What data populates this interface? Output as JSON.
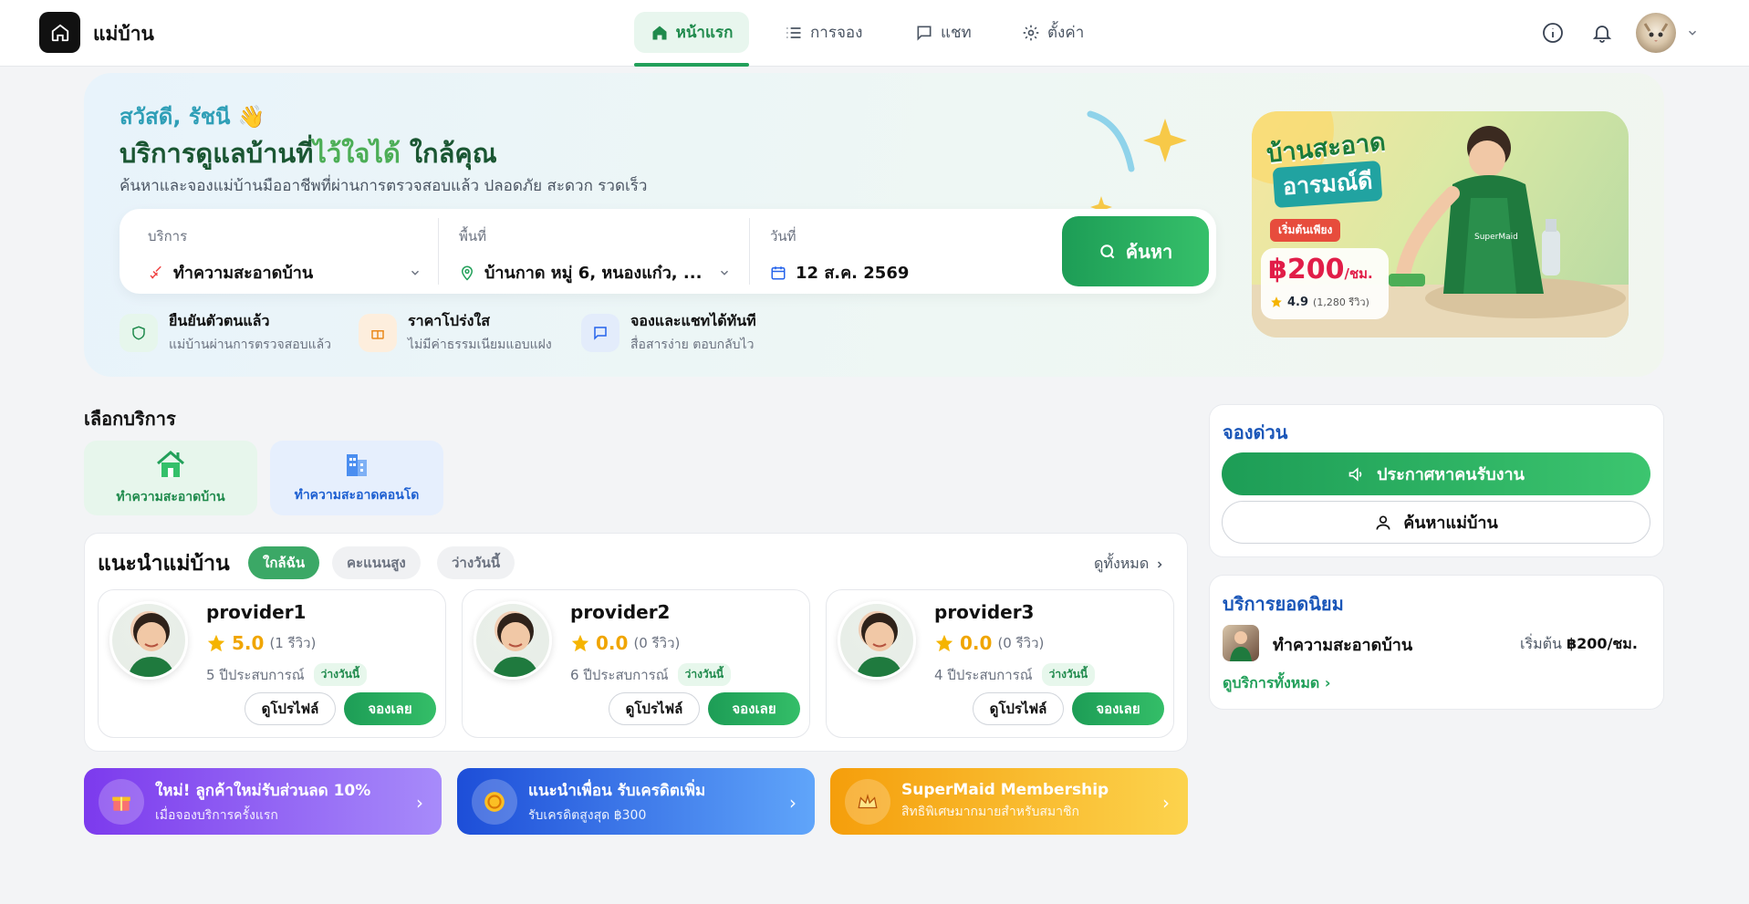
{
  "header": {
    "brand": "แม่บ้าน",
    "nav": [
      {
        "label": "หน้าแรก",
        "icon": "home-icon"
      },
      {
        "label": "การจอง",
        "icon": "list-icon"
      },
      {
        "label": "แชท",
        "icon": "chat-icon"
      },
      {
        "label": "ตั้งค่า",
        "icon": "gear-icon"
      }
    ]
  },
  "hero": {
    "greeting": "สวัสดี, รัชนี 👋",
    "headline_a": "บริการดูแลบ้านที่",
    "headline_b": "ไว้ใจได้",
    "headline_c": " ใกล้คุณ",
    "subtitle": "ค้นหาและจองแม่บ้านมืออาชีพที่ผ่านการตรวจสอบแล้ว ปลอดภัย สะดวก รวดเร็ว",
    "search": {
      "service_label": "บริการ",
      "service_value": "ทำความสะอาดบ้าน",
      "area_label": "พื้นที่",
      "area_value": "บ้านกาด หมู่ 6, หนองแก๋ว, ...",
      "date_label": "วันที่",
      "date_value": "12 ส.ค. 2569",
      "button": "ค้นหา"
    },
    "features": [
      {
        "title": "ยืนยันตัวตนแล้ว",
        "sub": "แม่บ้านผ่านการตรวจสอบแล้ว"
      },
      {
        "title": "ราคาโปร่งใส",
        "sub": "ไม่มีค่าธรรมเนียมแอบแฝง"
      },
      {
        "title": "จองและแชทได้ทันที",
        "sub": "สื่อสารง่าย ตอบกลับไว"
      }
    ],
    "promo": {
      "line1": "บ้านสะอาด",
      "line2": "อารมณ์ดี",
      "tag": "เริ่มต้นเพียง",
      "price": "฿200",
      "unit": "/ชม.",
      "rating": "4.9",
      "reviews": "(1,280 รีวิว)",
      "apron": "SuperMaid"
    }
  },
  "services": {
    "title": "เลือกบริการ",
    "items": [
      {
        "label": "ทำความสะอาดบ้าน"
      },
      {
        "label": "ทำความสะอาดคอนโด"
      }
    ]
  },
  "recommend": {
    "title": "แนะนำแม่บ้าน",
    "filters": [
      "ใกล้ฉัน",
      "คะแนนสูง",
      "ว่างวันนี้"
    ],
    "see_all": "ดูทั้งหมด",
    "providers": [
      {
        "name": "provider1",
        "rating": "5.0",
        "reviews": "(1 รีวิว)",
        "experience": "5 ปีประสบการณ์",
        "badge": "ว่างวันนี้",
        "profile": "ดูโปรไฟล์",
        "book": "จองเลย"
      },
      {
        "name": "provider2",
        "rating": "0.0",
        "reviews": "(0 รีวิว)",
        "experience": "6 ปีประสบการณ์",
        "badge": "ว่างวันนี้",
        "profile": "ดูโปรไฟล์",
        "book": "จองเลย"
      },
      {
        "name": "provider3",
        "rating": "0.0",
        "reviews": "(0 รีวิว)",
        "experience": "4 ปีประสบการณ์",
        "badge": "ว่างวันนี้",
        "profile": "ดูโปรไฟล์",
        "book": "จองเลย"
      }
    ]
  },
  "banners": [
    {
      "title": "ใหม่! ลูกค้าใหม่รับส่วนลด 10%",
      "sub": "เมื่อจองบริการครั้งแรก",
      "icon": "gift-icon",
      "color_from": "#7c3aed",
      "color_to": "#a78bfa"
    },
    {
      "title": "แนะนำเพื่อน รับเครดิตเพิ่ม",
      "sub": "รับเครดิตสูงสุด ฿300",
      "icon": "coin-icon",
      "color_from": "#1d4ed8",
      "color_to": "#60a5fa"
    },
    {
      "title": "SuperMaid Membership",
      "sub": "สิทธิพิเศษมากมายสำหรับสมาชิก",
      "icon": "crown-icon",
      "color_from": "#f59e0b",
      "color_to": "#fcd34d"
    }
  ],
  "quick": {
    "title": "จองด่วน",
    "announce": "ประกาศหาคนรับงาน",
    "find": "ค้นหาแม่บ้าน"
  },
  "popular": {
    "title": "บริการยอดนิยม",
    "item": "ทำความสะอาดบ้าน",
    "price_prefix": "เริ่มต้น ",
    "price": "฿200/ชม.",
    "see_all": "ดูบริการทั้งหมด ›"
  }
}
